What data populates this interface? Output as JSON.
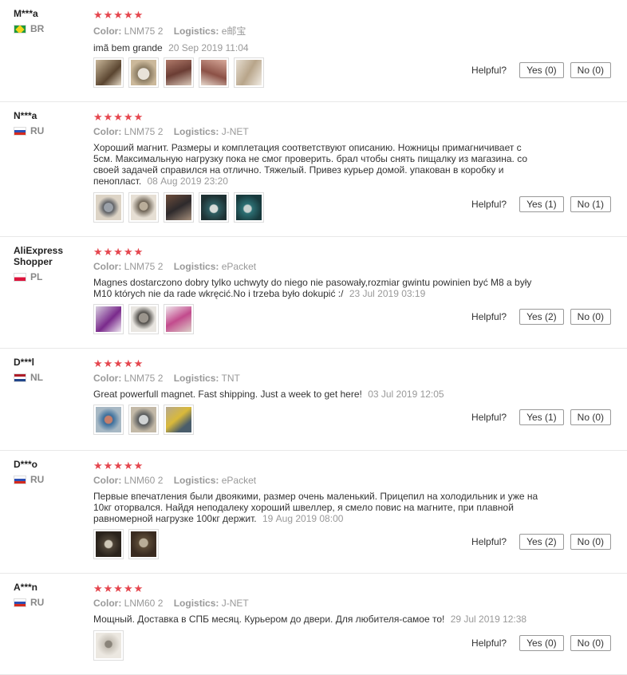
{
  "helpful_label": "Helpful?",
  "reviews": [
    {
      "user": "M***a",
      "country": "BR",
      "flag": "br",
      "stars": "★★★★★",
      "color_label": "Color:",
      "color": "LNM75 2",
      "logistics_label": "Logistics:",
      "logistics": "e邮宝",
      "text": "imã bem grande",
      "date": "20 Sep 2019 11:04",
      "yes": "Yes (0)",
      "no": "No (0)"
    },
    {
      "user": "N***a",
      "country": "RU",
      "flag": "ru",
      "stars": "★★★★★",
      "color_label": "Color:",
      "color": "LNM75 2",
      "logistics_label": "Logistics:",
      "logistics": "J-NET",
      "text": "Хороший магнит. Размеры и комплетация соответствуют описанию. Ножницы примагничивает с 5см. Максимальную нагрузку пока не смог проверить. брал чтобы снять пищалку из магазина. со своей задачей справился на отлично. Тяжелый. Привез курьер домой. упакован в коробку и пенопласт.",
      "date": "08 Aug 2019 23:20",
      "yes": "Yes (1)",
      "no": "No (1)"
    },
    {
      "user": "AliExpress Shopper",
      "country": "PL",
      "flag": "pl",
      "stars": "★★★★★",
      "color_label": "Color:",
      "color": "LNM75 2",
      "logistics_label": "Logistics:",
      "logistics": "ePacket",
      "text": "Magnes dostarczono dobry tylko uchwyty do niego nie pasowały,rozmiar gwintu powinien być M8 a były M10 których nie da rade wkręcić.No i trzeba było dokupić :/",
      "date": "23 Jul 2019 03:19",
      "yes": "Yes (2)",
      "no": "No (0)"
    },
    {
      "user": "D***l",
      "country": "NL",
      "flag": "nl",
      "stars": "★★★★★",
      "color_label": "Color:",
      "color": "LNM75 2",
      "logistics_label": "Logistics:",
      "logistics": "TNT",
      "text": "Great powerfull magnet. Fast shipping. Just a week to get here!",
      "date": "03 Jul 2019 12:05",
      "yes": "Yes (1)",
      "no": "No (0)"
    },
    {
      "user": "D***o",
      "country": "RU",
      "flag": "ru",
      "stars": "★★★★★",
      "color_label": "Color:",
      "color": "LNM60 2",
      "logistics_label": "Logistics:",
      "logistics": "ePacket",
      "text": "Первые впечатления были двоякими, размер очень маленький. Прицепил на холодильник и уже на 10кг оторвался. Найдя неподалеку хороший швеллер, я смело повис на магните, при плавной равномерной нагрузке 100кг держит.",
      "date": "19 Aug 2019 08:00",
      "yes": "Yes (2)",
      "no": "No (0)"
    },
    {
      "user": "A***n",
      "country": "RU",
      "flag": "ru",
      "stars": "★★★★★",
      "color_label": "Color:",
      "color": "LNM60 2",
      "logistics_label": "Logistics:",
      "logistics": "J-NET",
      "text": "Мощный. Доставка в СПБ месяц. Курьером до двери. Для любителя-самое то!",
      "date": "29 Jul 2019 12:38",
      "yes": "Yes (0)",
      "no": "No (0)"
    }
  ]
}
